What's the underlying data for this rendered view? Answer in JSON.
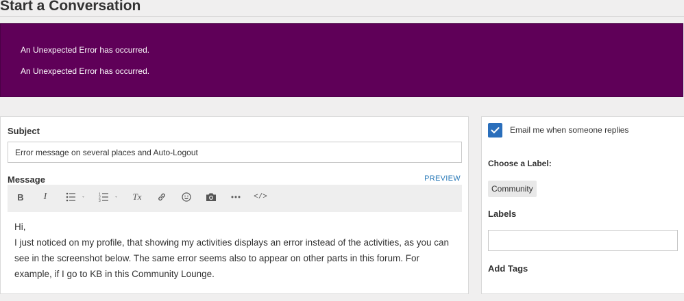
{
  "page": {
    "title": "Start a Conversation"
  },
  "errors": [
    "An Unexpected Error has occurred.",
    "An Unexpected Error has occurred."
  ],
  "colors": {
    "banner_bg": "#5f0058",
    "accent_blue": "#2a6ebb",
    "link_blue": "#2a7ab8",
    "page_bg": "#f0efef"
  },
  "form": {
    "subject_label": "Subject",
    "subject_value": "Error message on several places and Auto-Logout",
    "message_label": "Message",
    "preview_label": "PREVIEW",
    "toolbar": [
      {
        "name": "bold-icon",
        "label": "B"
      },
      {
        "name": "italic-icon",
        "label": "I"
      },
      {
        "name": "bulleted-list-icon"
      },
      {
        "name": "numbered-list-icon"
      },
      {
        "name": "clear-formatting-icon",
        "label": "Tx"
      },
      {
        "name": "link-icon"
      },
      {
        "name": "emoji-icon"
      },
      {
        "name": "camera-icon"
      },
      {
        "name": "more-icon"
      },
      {
        "name": "source-code-icon",
        "label": "</>"
      }
    ],
    "message_lines": [
      "Hi,",
      "I just noticed on my profile, that showing my activities displays an error instead of the activities, as you can see in the screenshot below. The same error seems also to appear on other parts in this forum. For example, if I go to KB in this Community Lounge."
    ]
  },
  "sidebar": {
    "email_notify_label": "Email me when someone replies",
    "email_notify_checked": true,
    "choose_label_heading": "Choose a Label:",
    "label_options": [
      "Community"
    ],
    "labels_heading": "Labels",
    "labels_value": "",
    "add_tags_heading": "Add Tags"
  }
}
